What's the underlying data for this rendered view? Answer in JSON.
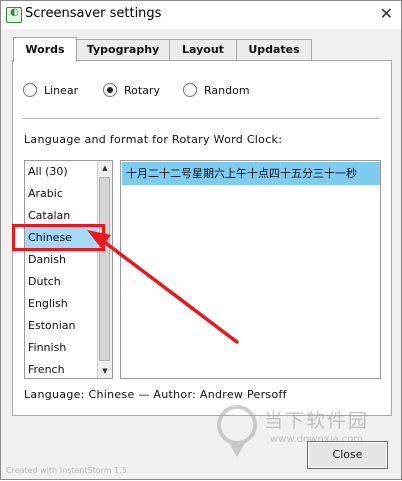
{
  "window": {
    "title": "Screensaver settings",
    "close_glyph": "✕",
    "app_icon": "screensaver-app-icon"
  },
  "tabs": [
    {
      "label": "Words",
      "active": true
    },
    {
      "label": "Typography",
      "active": false
    },
    {
      "label": "Layout",
      "active": false
    },
    {
      "label": "Updates",
      "active": false
    }
  ],
  "modes": [
    {
      "label": "Linear",
      "selected": false
    },
    {
      "label": "Rotary",
      "selected": true
    },
    {
      "label": "Random",
      "selected": false
    }
  ],
  "language_format_label": "Language and format for Rotary Word Clock:",
  "languages": [
    "All (30)",
    "Arabic",
    "Catalan",
    "Chinese",
    "Danish",
    "Dutch",
    "English",
    "Estonian",
    "Finnish",
    "French"
  ],
  "selected_language": "Chinese",
  "preview_text": "十月二十二号星期六上午十点四十五分三十一秒",
  "language_author": "Language: Chinese — Author: Andrew Persoff",
  "close_button": "Close",
  "credit": "Created with InstantStorm 1.5",
  "watermark": {
    "text": "当下软件园",
    "url": "www.downxia.com"
  },
  "colors": {
    "selection": "#a6d8f5",
    "preview_highlight": "#7ecbef",
    "annotation": "#e8181e"
  }
}
